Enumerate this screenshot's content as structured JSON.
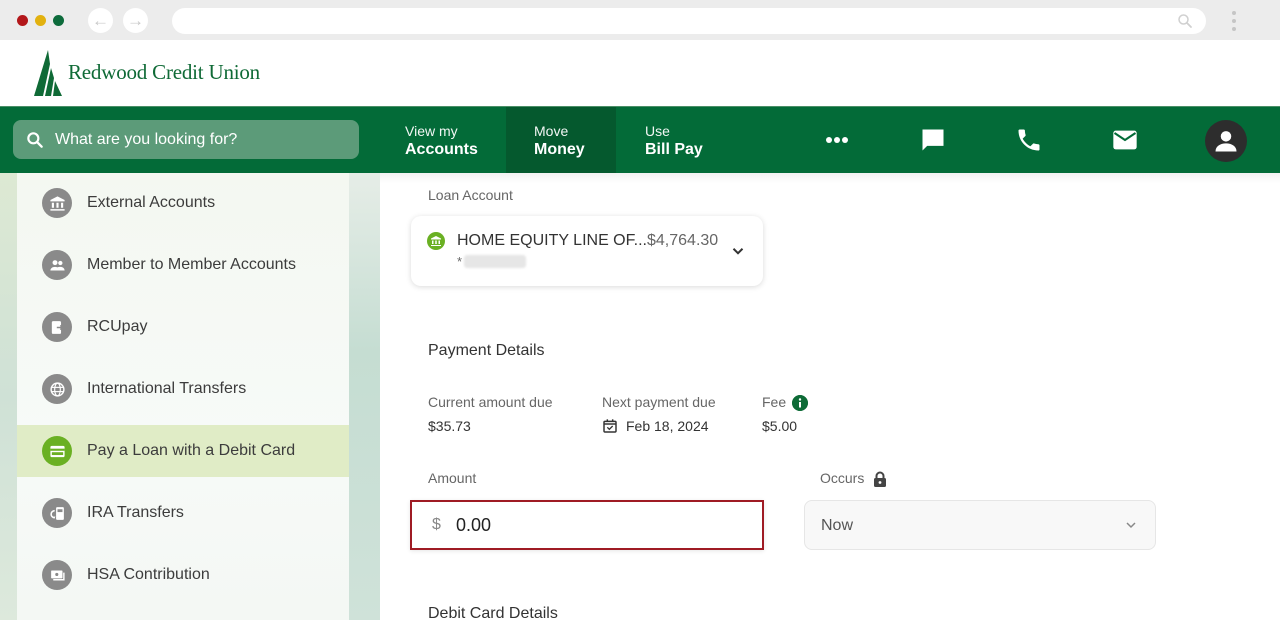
{
  "browser": {
    "back_icon": "arrow-left-icon",
    "forward_icon": "arrow-right-icon",
    "url": "",
    "search_icon": "search-icon",
    "menu_icon": "kebab-menu-icon"
  },
  "brand": {
    "name": "Redwood Credit Union",
    "color": "#036b38",
    "accent": "#6ab023"
  },
  "nav": {
    "search_placeholder": "What are you looking for?",
    "items": [
      {
        "small": "View my",
        "big": "Accounts"
      },
      {
        "small": "Move",
        "big": "Money",
        "active": true
      },
      {
        "small": "Use",
        "big": "Bill Pay"
      }
    ],
    "icons": [
      "more-icon",
      "chat-icon",
      "phone-icon",
      "mail-icon",
      "profile-icon"
    ]
  },
  "sidebar": {
    "items": [
      {
        "label": "External Accounts",
        "icon": "bank-icon"
      },
      {
        "label": "Member to Member Accounts",
        "icon": "people-icon"
      },
      {
        "label": "RCUpay",
        "icon": "rcupay-icon"
      },
      {
        "label": "International Transfers",
        "icon": "globe-icon"
      },
      {
        "label": "Pay a Loan with a Debit Card",
        "icon": "credit-card-icon",
        "active": true
      },
      {
        "label": "IRA Transfers",
        "icon": "ira-transfer-icon"
      },
      {
        "label": "HSA Contribution",
        "icon": "cash-icon"
      }
    ]
  },
  "main": {
    "loan_account_label": "Loan Account",
    "loan": {
      "name": "HOME EQUITY LINE OF...",
      "balance": "$4,764.30",
      "account_prefix": "*"
    },
    "payment_details_title": "Payment Details",
    "current_amount_due_label": "Current amount due",
    "current_amount_due": "$35.73",
    "next_payment_due_label": "Next payment due",
    "next_payment_due": "Feb 18, 2024",
    "fee_label": "Fee",
    "fee": "$5.00",
    "amount_label": "Amount",
    "currency_symbol": "$",
    "amount_value": "0.00",
    "occurs_label": "Occurs",
    "occurs_value": "Now",
    "debit_card_details_title": "Debit Card Details"
  }
}
